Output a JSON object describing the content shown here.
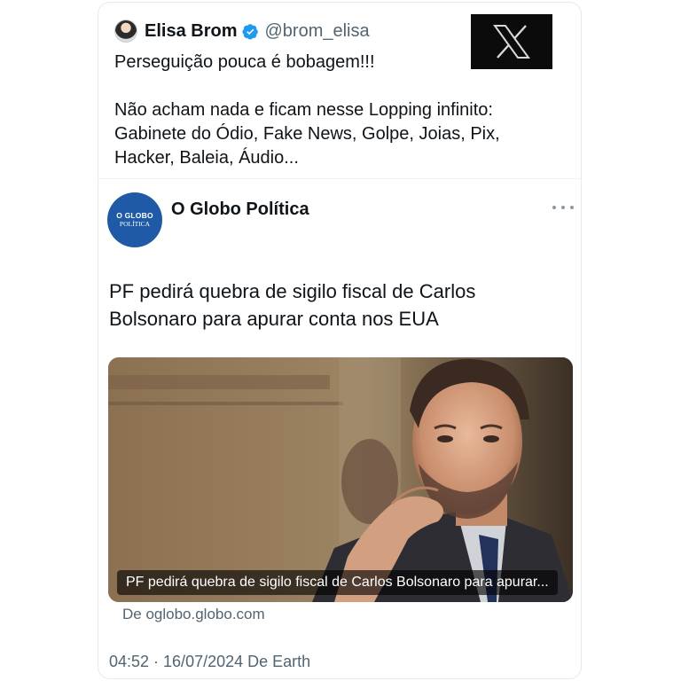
{
  "tweet": {
    "author_name": "Elisa Brom",
    "handle": "@brom_elisa",
    "text_line1": "Perseguição pouca é bobagem!!!",
    "text_line2": "Não acham nada e ficam nesse Lopping infinito:",
    "text_line3": "Gabinete do Ódio, Fake News, Golpe, Joias, Pix,",
    "text_line4": "Hacker, Baleia, Áudio...",
    "timestamp": "04:52 · 16/07/2024 De Earth"
  },
  "branding": {
    "x_logo": "X"
  },
  "quote": {
    "account_name": "O Globo Política",
    "logo_line1": "O GLOBO",
    "logo_line2": "POLÍTICA",
    "title_line1": "PF pedirá quebra de sigilo fiscal de Carlos",
    "title_line2": "Bolsonaro para apurar conta nos EUA",
    "media_caption": "PF pedirá quebra de sigilo fiscal de Carlos Bolsonaro para apurar...",
    "source_link": "De oglobo.globo.com"
  },
  "colors": {
    "verified_blue": "#1d9bf0",
    "globo_blue": "#1f5aa6",
    "secondary_text": "#536471"
  },
  "icons": {
    "verified": "verified-badge-icon",
    "more": "more-options-icon"
  }
}
